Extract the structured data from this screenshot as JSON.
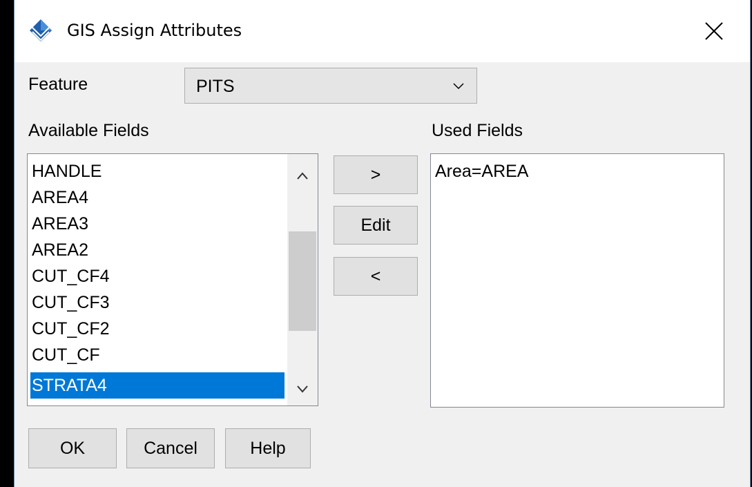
{
  "window": {
    "title": "GIS Assign Attributes",
    "icon": "pyramid-app-icon",
    "close_icon": "close-icon"
  },
  "feature": {
    "label": "Feature",
    "selected": "PITS"
  },
  "available": {
    "label": "Available Fields",
    "items": [
      "HANDLE",
      "AREA4",
      "AREA3",
      "AREA2",
      "CUT_CF4",
      "CUT_CF3",
      "CUT_CF2",
      "CUT_CF",
      "STRATA4"
    ],
    "selected_item": "STRATA4"
  },
  "used": {
    "label": "Used Fields",
    "items": [
      "Area=AREA"
    ]
  },
  "transfer": {
    "add": ">",
    "edit": "Edit",
    "remove": "<"
  },
  "footer": {
    "ok": "OK",
    "cancel": "Cancel",
    "help": "Help"
  },
  "colors": {
    "selection": "#0078d7",
    "dialog_bg": "#f0f0f0",
    "icon_blue": "#1f5fae"
  }
}
